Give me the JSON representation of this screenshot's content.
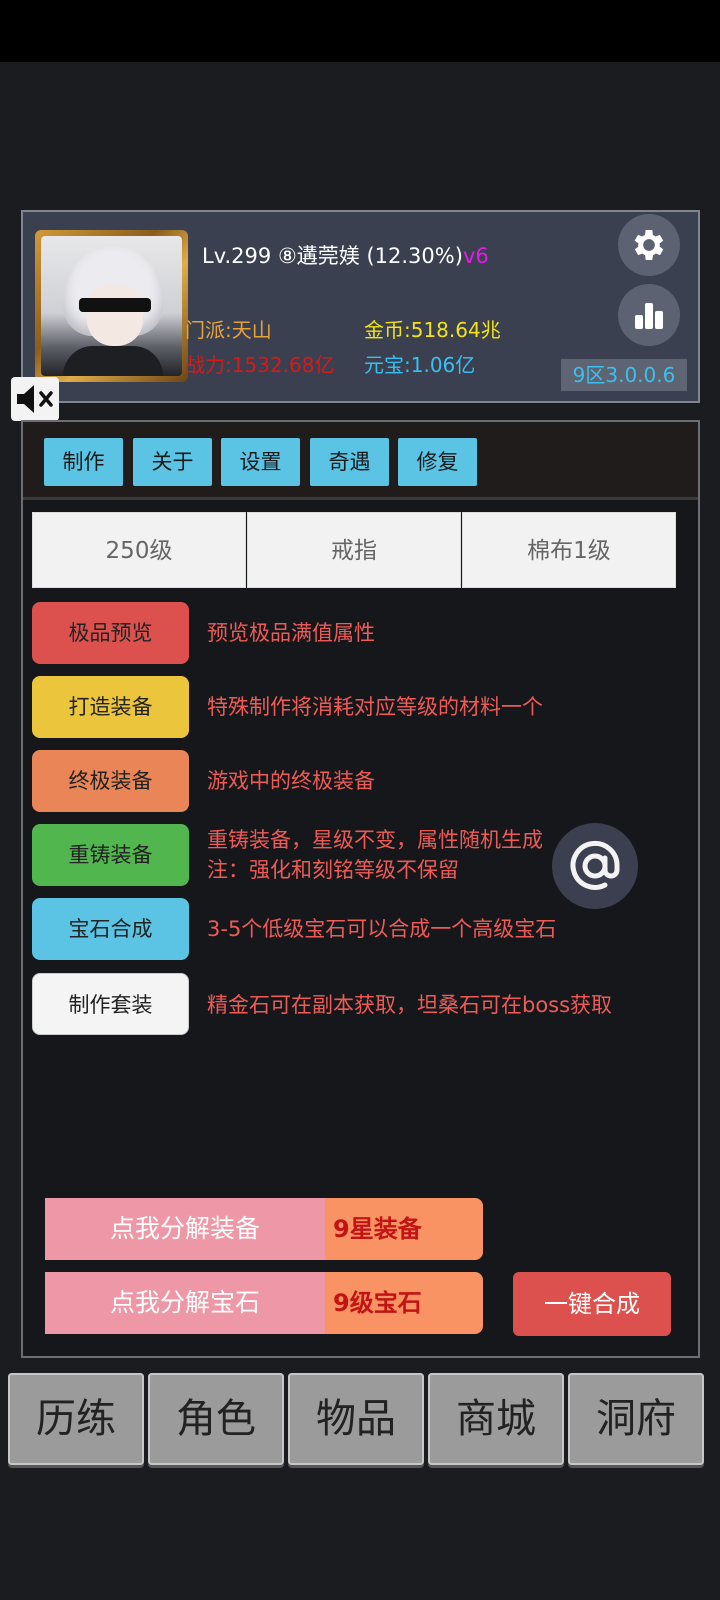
{
  "header": {
    "level": "Lv.299",
    "rank_name": "⑧遘莞媄",
    "progress": "(12.30%)",
    "vip": "v6",
    "sect": "门派:天山",
    "power": "战力:1532.68亿",
    "gold": "金币:518.64兆",
    "ingot": "元宝:1.06亿",
    "version": "9区3.0.0.6",
    "icons": [
      "gear-icon",
      "bar-chart-icon",
      "mute-icon",
      "avatar"
    ]
  },
  "tabs": [
    {
      "label": "制作"
    },
    {
      "label": "关于"
    },
    {
      "label": "设置"
    },
    {
      "label": "奇遇"
    },
    {
      "label": "修复"
    }
  ],
  "filters": [
    {
      "label": "250级"
    },
    {
      "label": "戒指"
    },
    {
      "label": "棉布1级"
    }
  ],
  "actions": [
    {
      "label": "极品预览",
      "desc": "预览极品满值属性",
      "color": "#dc514e"
    },
    {
      "label": "打造装备",
      "desc": "特殊制作将消耗对应等级的材料一个",
      "color": "#ebc53b"
    },
    {
      "label": "终极装备",
      "desc": "游戏中的终极装备",
      "color": "#e98557"
    },
    {
      "label": "重铸装备",
      "desc": "重铸装备，星级不变，属性随机生成",
      "desc2": "注：强化和刻铭等级不保留",
      "color": "#52b64e"
    },
    {
      "label": "宝石合成",
      "desc": "3-5个低级宝石可以合成一个高级宝石",
      "color": "#5bc4e4"
    },
    {
      "label": "制作套装",
      "desc": "精金石可在副本获取，坦桑石可在boss获取",
      "color": "#f4f4f4"
    }
  ],
  "decompose": {
    "equip_label": "点我分解装备",
    "equip_selected": "9星装备",
    "gem_label": "点我分解宝石",
    "gem_selected": "9级宝石",
    "onekey_label": "一键合成"
  },
  "floating": {
    "at_icon": "at-icon"
  },
  "nav": [
    {
      "label": "历练"
    },
    {
      "label": "角色"
    },
    {
      "label": "物品"
    },
    {
      "label": "商城"
    },
    {
      "label": "洞府"
    }
  ]
}
